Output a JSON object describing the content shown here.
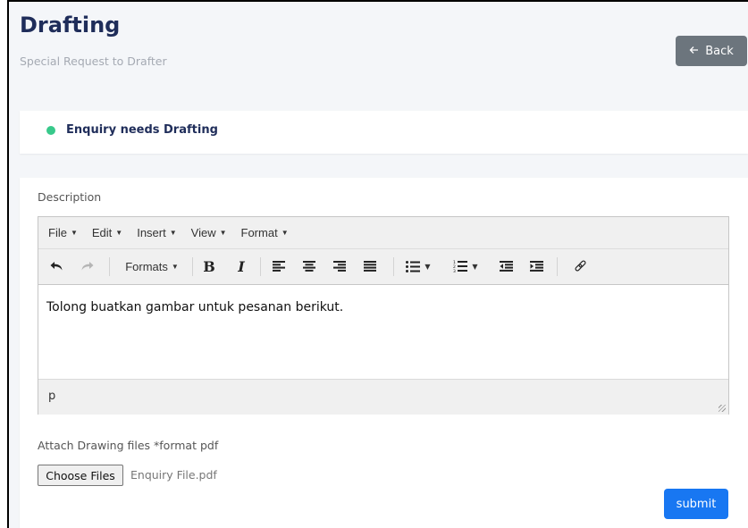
{
  "header": {
    "title": "Drafting",
    "subtitle": "Special Request to Drafter",
    "back_label": "Back",
    "back_icon": "arrow-left-icon"
  },
  "status": {
    "text": "Enquiry needs Drafting",
    "dot_color": "#38c98b"
  },
  "form": {
    "description_label": "Description",
    "editor": {
      "menu": [
        "File",
        "Edit",
        "Insert",
        "View",
        "Format"
      ],
      "toolbar": {
        "formats_label": "Formats",
        "buttons": [
          "undo-icon",
          "redo-icon",
          "bold-icon",
          "italic-icon",
          "align-left-icon",
          "align-center-icon",
          "align-right-icon",
          "align-justify-icon",
          "bullet-list-icon",
          "numbered-list-icon",
          "outdent-icon",
          "indent-icon",
          "link-icon"
        ]
      },
      "content": "Tolong buatkan gambar untuk pesanan berikut.",
      "path": "p"
    },
    "attach_label": "Attach Drawing files *format pdf",
    "choose_button": "Choose Files",
    "file_name": "Enquiry File.pdf",
    "submit_label": "submit"
  },
  "colors": {
    "title": "#1f2d5a",
    "back_button": "#6c757d",
    "submit_button": "#1877f2",
    "status_dot": "#38c98b"
  }
}
